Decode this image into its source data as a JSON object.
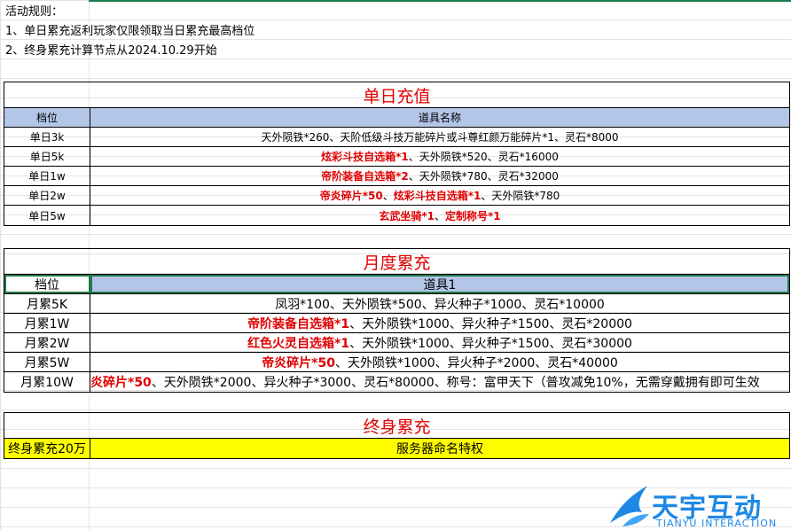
{
  "notes": {
    "line1": "活动规则：",
    "line2": "1、单日累充返利玩家仅限领取当日累充最高档位",
    "line3": "2、终身累充计算节点从2024.10.29开始"
  },
  "daily": {
    "title": "单日充值",
    "header": {
      "tier": "档位",
      "items": "道具名称"
    },
    "rows": [
      {
        "tier": "单日3k",
        "segs": [
          {
            "t": "天外陨铁*260、天阶低级斗技万能碎片或斗尊红颜万能碎片*1、灵石*8000",
            "red": false
          }
        ]
      },
      {
        "tier": "单日5k",
        "segs": [
          {
            "t": "炫彩斗技自选箱*1",
            "red": true
          },
          {
            "t": "、天外陨铁*520、灵石*16000",
            "red": false
          }
        ]
      },
      {
        "tier": "单日1w",
        "segs": [
          {
            "t": "帝阶装备自选箱*2",
            "red": true
          },
          {
            "t": "、天外陨铁*780、灵石*32000",
            "red": false
          }
        ]
      },
      {
        "tier": "单日2w",
        "segs": [
          {
            "t": "帝炎碎片*50",
            "red": true
          },
          {
            "t": "、",
            "red": false
          },
          {
            "t": "炫彩斗技自选箱*1",
            "red": true
          },
          {
            "t": "、天外陨铁*780",
            "red": false
          }
        ]
      },
      {
        "tier": "单日5w",
        "segs": [
          {
            "t": "玄武坐骑*1",
            "red": true
          },
          {
            "t": "、",
            "red": false
          },
          {
            "t": "定制称号*1",
            "red": true
          }
        ]
      }
    ]
  },
  "monthly": {
    "title": "月度累充",
    "header": {
      "tier": "档位",
      "items": "道具1"
    },
    "rows": [
      {
        "tier": "月累5K",
        "segs": [
          {
            "t": "凤羽*100、天外陨铁*500、异火种子*1000、灵石*10000",
            "red": false
          }
        ]
      },
      {
        "tier": "月累1W",
        "segs": [
          {
            "t": "帝阶装备自选箱*1",
            "red": true
          },
          {
            "t": "、天外陨铁*1000、异火种子*1500、灵石*20000",
            "red": false
          }
        ]
      },
      {
        "tier": "月累2W",
        "segs": [
          {
            "t": "红色火灵自选箱*1",
            "red": true
          },
          {
            "t": "、天外陨铁*1000、异火种子*1500、灵石*30000",
            "red": false
          }
        ]
      },
      {
        "tier": "月累5W",
        "segs": [
          {
            "t": "帝炎碎片*50",
            "red": true
          },
          {
            "t": "、天外陨铁*1000、异火种子*2000、灵石*40000",
            "red": false
          }
        ]
      },
      {
        "tier": "月累10W",
        "segs": [
          {
            "t": "炎碎片*50",
            "red": true
          },
          {
            "t": "、天外陨铁*2000、异火种子*3000、灵石*80000、称号：富甲天下（普攻减免10%，无需穿戴拥有即可生效",
            "red": false
          }
        ]
      }
    ]
  },
  "lifetime": {
    "title": "终身累充",
    "rows": [
      {
        "tier": "终身累充20万",
        "item": "服务器命名特权"
      }
    ]
  },
  "logo": {
    "name": "天宇互动",
    "sub": "TIANYU INTERACTION",
    "color": "#1e88e5"
  },
  "colors": {
    "header_bg": "#b4c6e7",
    "highlight": "#e00000",
    "lifetime_bg": "#ffff00",
    "selection": "#1f7a4d"
  }
}
